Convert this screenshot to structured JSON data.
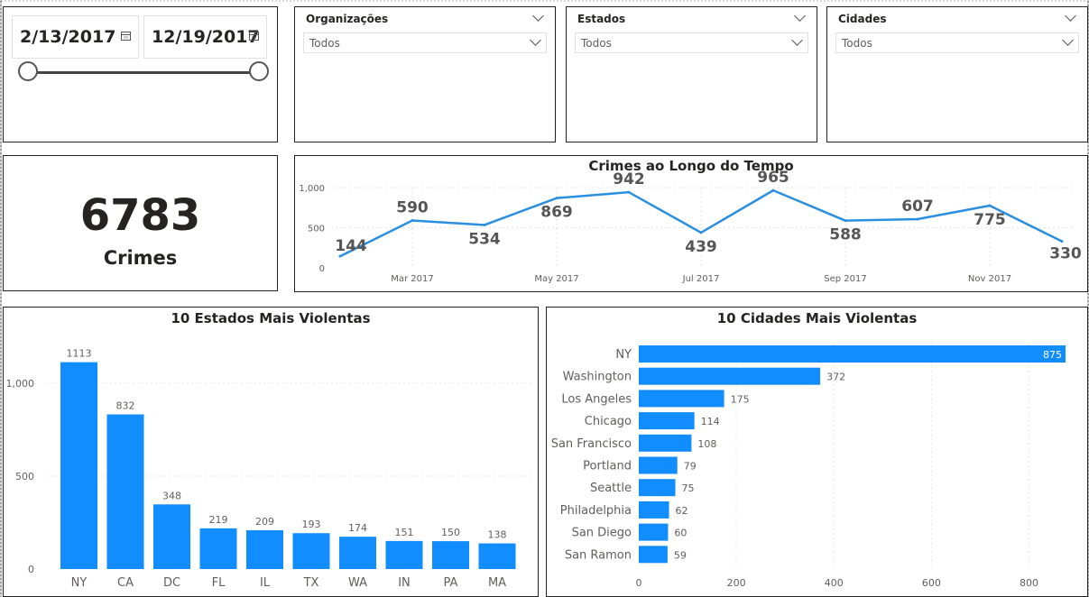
{
  "date_slicer": {
    "start": "2/13/2017",
    "end": "12/19/2017",
    "range_fraction": [
      0,
      1
    ]
  },
  "slicers": [
    {
      "title": "Organizações",
      "value": "Todos"
    },
    {
      "title": "Estados",
      "value": "Todos"
    },
    {
      "title": "Cidades",
      "value": "Todos"
    }
  ],
  "kpi": {
    "value": "6783",
    "label": "Crimes"
  },
  "colors": {
    "accent": "#118DFF",
    "line": "#2B8FE0",
    "border": "#222222",
    "text": "#252423",
    "axis": "#605E5C",
    "grid": "#E6E6E6"
  },
  "chart_data": [
    {
      "type": "line",
      "title": "Crimes ao Longo do Tempo",
      "x": [
        "Feb 2017",
        "Mar 2017",
        "Apr 2017",
        "May 2017",
        "Jun 2017",
        "Jul 2017",
        "Aug 2017",
        "Sep 2017",
        "Oct 2017",
        "Nov 2017",
        "Dec 2017"
      ],
      "x_tick_labels": [
        "Mar 2017",
        "May 2017",
        "Jul 2017",
        "Sep 2017",
        "Nov 2017"
      ],
      "values": [
        144,
        590,
        534,
        869,
        942,
        439,
        965,
        588,
        607,
        775,
        330
      ],
      "y_ticks": [
        0,
        500,
        1000
      ],
      "y_tick_labels": [
        "0",
        "500",
        "1,000"
      ],
      "ylim": [
        0,
        1000
      ],
      "grid": true
    },
    {
      "type": "bar",
      "title": "10 Estados Mais Violentas",
      "categories": [
        "NY",
        "CA",
        "DC",
        "FL",
        "IL",
        "TX",
        "WA",
        "IN",
        "PA",
        "MA"
      ],
      "values": [
        1113,
        832,
        348,
        219,
        209,
        193,
        174,
        151,
        150,
        138
      ],
      "y_ticks": [
        0,
        500,
        1000
      ],
      "y_tick_labels": [
        "0",
        "500",
        "1,000"
      ],
      "ylim": [
        0,
        1150
      ],
      "grid": true
    },
    {
      "type": "bar",
      "orientation": "horizontal",
      "title": "10 Cidades Mais Violentas",
      "categories": [
        "NY",
        "Washington",
        "Los Angeles",
        "Chicago",
        "San Francisco",
        "Portland",
        "Seattle",
        "Philadelphia",
        "San Diego",
        "San Ramon"
      ],
      "values": [
        875,
        372,
        175,
        114,
        108,
        79,
        75,
        62,
        60,
        59
      ],
      "x_ticks": [
        0,
        200,
        400,
        600,
        800
      ],
      "x_tick_labels": [
        "0",
        "200",
        "400",
        "600",
        "800"
      ],
      "xlim": [
        0,
        875
      ],
      "grid": true
    }
  ]
}
